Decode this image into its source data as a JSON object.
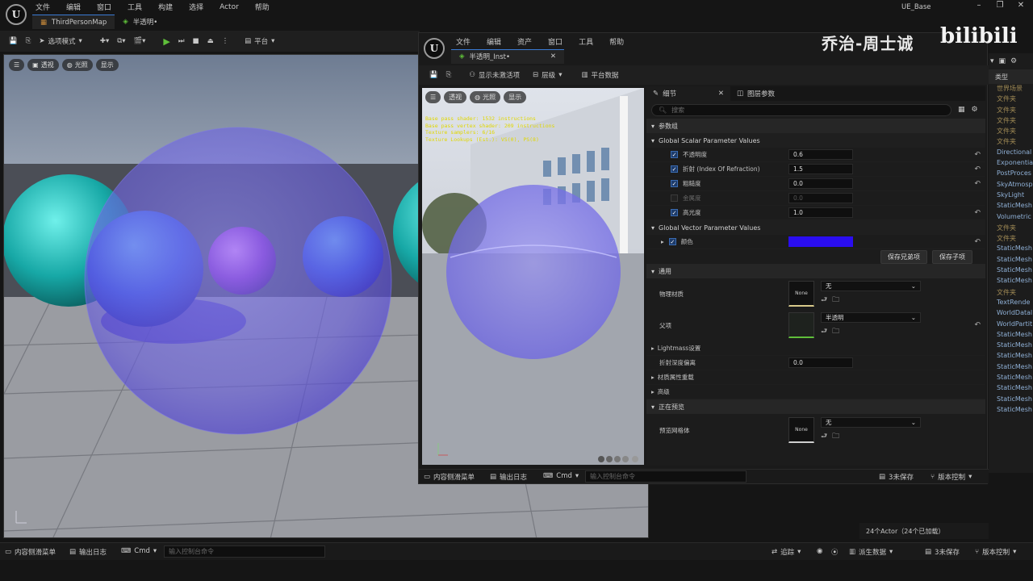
{
  "main_window": {
    "menu": [
      "文件",
      "编辑",
      "窗口",
      "工具",
      "构建",
      "选择",
      "Actor",
      "帮助"
    ],
    "project_name": "UE_Base",
    "tabs": [
      {
        "label": "ThirdPersonMap"
      },
      {
        "label": "半透明•"
      }
    ],
    "toolbar": {
      "mode_label": "选项模式",
      "platform_label": "平台"
    },
    "viewport": {
      "chips": [
        "透视",
        "光照",
        "显示"
      ]
    },
    "outliner": {
      "header": "类型",
      "items": [
        "世界场景",
        "文件夹",
        "文件夹",
        "文件夹",
        "文件夹",
        "文件夹",
        "Directional",
        "Exponentia",
        "PostProces",
        "SkyAtmosp",
        "SkyLight",
        "StaticMesh",
        "Volumetric",
        "文件夹",
        "文件夹",
        "StaticMesh",
        "StaticMesh",
        "StaticMesh",
        "StaticMesh",
        "文件夹",
        "TextRende",
        "WorldDatal",
        "WorldPartit",
        "StaticMesh",
        "StaticMesh",
        "StaticMesh",
        "StaticMesh",
        "StaticMesh",
        "StaticMesh",
        "StaticMesh",
        "StaticMesh"
      ]
    },
    "actor_count": "24个Actor（24个已加载）",
    "bottom": {
      "content_drawer": "内容侧滑菜单",
      "output_log": "输出日志",
      "cmd": "Cmd",
      "console_placeholder": "输入控制台命令",
      "trace": "追踪",
      "derived_data": "派生数据",
      "unsaved": "3未保存",
      "source_control": "版本控制"
    }
  },
  "material_editor": {
    "menu": [
      "文件",
      "编辑",
      "资产",
      "窗口",
      "工具",
      "帮助"
    ],
    "tab_label": "半透明_Inst•",
    "toolbar": {
      "show_inactive": "显示未激活项",
      "hierarchy": "层级",
      "platform_stats": "平台数据"
    },
    "preview": {
      "chips": [
        "透视",
        "光照",
        "显示"
      ],
      "stats": [
        "Base pass shader: 1532 instructions",
        "Base pass vertex shader: 209 instructions",
        "Texture samplers: 6/16",
        "Texture Lookups (Est.): VS(0), PS(8)"
      ]
    },
    "details": {
      "tabs": [
        {
          "label": "细节"
        },
        {
          "label": "图层参数"
        }
      ],
      "search_placeholder": "搜索",
      "param_group": "参数组",
      "scalar_header": "Global Scalar Parameter Values",
      "scalar_params": [
        {
          "name": "不透明度",
          "value": "0.6",
          "enabled": true
        },
        {
          "name": "折射 (Index Of Refraction)",
          "value": "1.5",
          "enabled": true
        },
        {
          "name": "粗糙度",
          "value": "0.0",
          "enabled": true
        },
        {
          "name": "金属度",
          "value": "0.0",
          "enabled": false
        },
        {
          "name": "高光度",
          "value": "1.0",
          "enabled": true
        }
      ],
      "vector_header": "Global Vector Parameter Values",
      "color_param": {
        "name": "颜色",
        "color": "#2a0df0"
      },
      "save_sibling": "保存兄弟项",
      "save_child": "保存子项",
      "general_header": "通用",
      "phys_material_label": "物理材质",
      "phys_material_value": "无",
      "parent_label": "父项",
      "parent_value": "半透明",
      "lightmass_label": "Lightmass设置",
      "refraction_depth_label": "折射深度偏离",
      "refraction_depth_value": "0.0",
      "property_override_label": "材质属性重载",
      "advanced_label": "高级",
      "previewing_header": "正在预览",
      "preview_mesh_label": "预览网格体",
      "preview_mesh_value": "无",
      "none_thumb": "None"
    },
    "bottom": {
      "content_drawer": "内容侧滑菜单",
      "output_log": "输出日志",
      "cmd": "Cmd",
      "console_placeholder": "输入控制台命令",
      "unsaved": "3未保存",
      "source_control": "版本控制"
    }
  },
  "watermark": {
    "text": "乔治-周士诚",
    "logo": "bilibili"
  },
  "colors": {
    "accent": "#3a7bd5",
    "play": "#5fbf3a",
    "tint": "#2a0df0",
    "stats": "#e0d700"
  }
}
